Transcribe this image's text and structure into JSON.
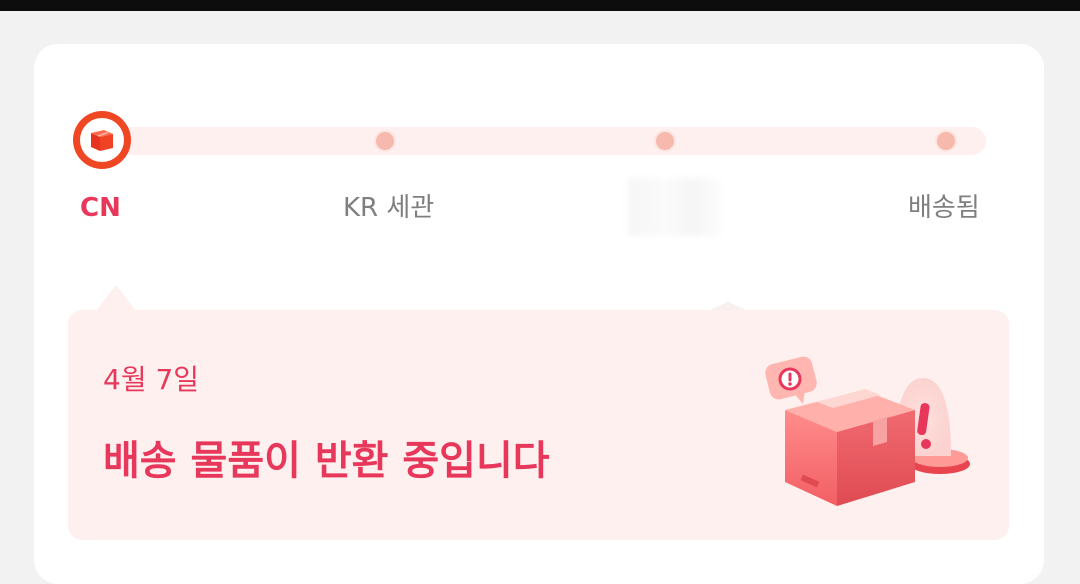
{
  "colors": {
    "accent": "#e7385b",
    "step_active": "#ef4623",
    "track": "#fdf0ee",
    "inactive_dot": "#f7b8ae",
    "inactive_text": "#7f7f7f"
  },
  "tracker": {
    "current_step_index": 0,
    "current_step_icon": "box-icon",
    "steps": [
      {
        "label": "CN",
        "active": true
      },
      {
        "label": "KR 세관",
        "active": false
      },
      {
        "label": "",
        "active": false,
        "note": "label obscured"
      },
      {
        "label": "배송됨",
        "active": false
      }
    ]
  },
  "status_panel": {
    "date": "4월 7일",
    "message": "배송 물품이 반환 중입니다",
    "illustration_icon": "return-package-warning-icon"
  }
}
